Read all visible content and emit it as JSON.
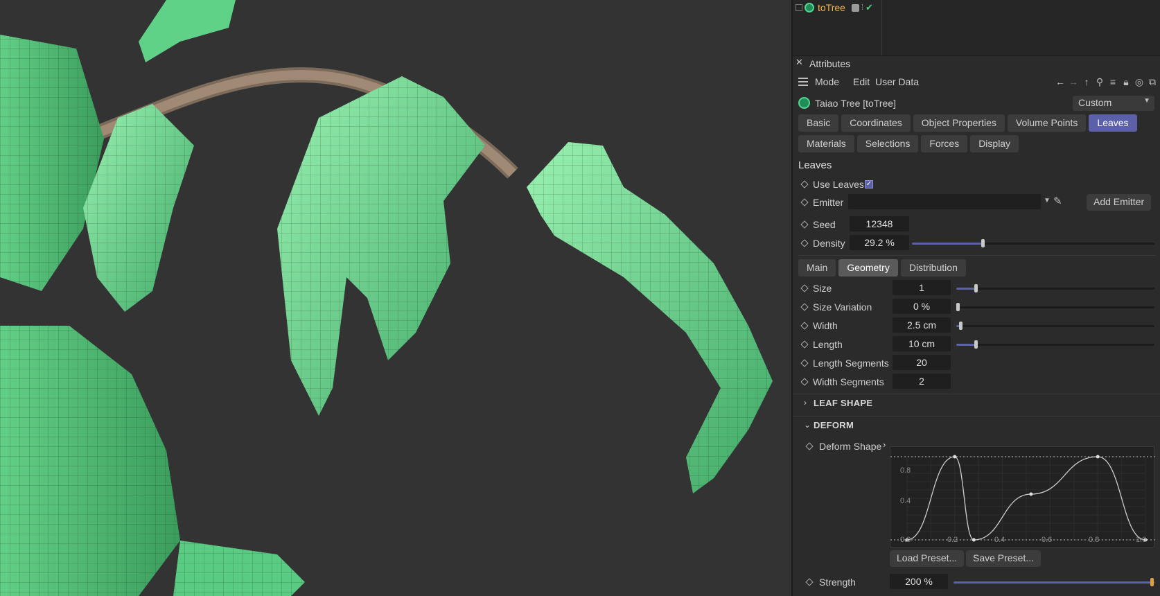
{
  "object_manager": {
    "object_name": "toTree"
  },
  "attributes": {
    "title": "Attributes",
    "menu": [
      "Mode",
      "Edit",
      "User Data"
    ],
    "object_title": "Taiao Tree [toTree]",
    "mode_select": "Custom",
    "tabs_row1": [
      "Basic",
      "Coordinates",
      "Object Properties",
      "Volume Points",
      "Leaves"
    ],
    "tabs_row2": [
      "Materials",
      "Selections",
      "Forces",
      "Display"
    ],
    "active_tab": "Leaves",
    "section_title": "Leaves",
    "use_leaves": {
      "label": "Use Leaves",
      "checked": true
    },
    "emitter": {
      "label": "Emitter",
      "value": "",
      "button": "Add Emitter"
    },
    "seed": {
      "label": "Seed",
      "value": "12348"
    },
    "density": {
      "label": "Density",
      "value": "29.2 %",
      "fraction": 0.292
    },
    "subtabs": [
      "Main",
      "Geometry",
      "Distribution"
    ],
    "active_subtab": "Geometry",
    "geometry": {
      "size": {
        "label": "Size",
        "value": "1",
        "fraction": 0.1
      },
      "size_variation": {
        "label": "Size Variation",
        "value": "0 %",
        "fraction": 0.0
      },
      "width": {
        "label": "Width",
        "value": "2.5 cm",
        "fraction": 0.02
      },
      "length": {
        "label": "Length",
        "value": "10 cm",
        "fraction": 0.1
      },
      "length_segments": {
        "label": "Length Segments",
        "value": "20"
      },
      "width_segments": {
        "label": "Width Segments",
        "value": "2"
      }
    },
    "groups": {
      "leaf_shape": "LEAF SHAPE",
      "deform": "DEFORM"
    },
    "deform_shape": {
      "label": "Deform Shape",
      "x_ticks": [
        "0.0",
        "0.2",
        "0.4",
        "0.6",
        "0.8",
        "1.0"
      ],
      "y_ticks": [
        "0.8",
        "0.4"
      ],
      "points": [
        [
          0.0,
          0.0
        ],
        [
          0.2,
          1.0
        ],
        [
          0.28,
          0.0
        ],
        [
          0.52,
          0.55
        ],
        [
          0.8,
          1.0
        ],
        [
          1.0,
          0.0
        ]
      ]
    },
    "load_preset": "Load Preset...",
    "save_preset": "Save Preset...",
    "strength": {
      "label": "Strength",
      "value": "200 %",
      "fraction": 1.0
    }
  },
  "colors": {
    "accent": "#5b60a8",
    "leaf": "#6fdc90",
    "object_name": "#f5b53d"
  }
}
